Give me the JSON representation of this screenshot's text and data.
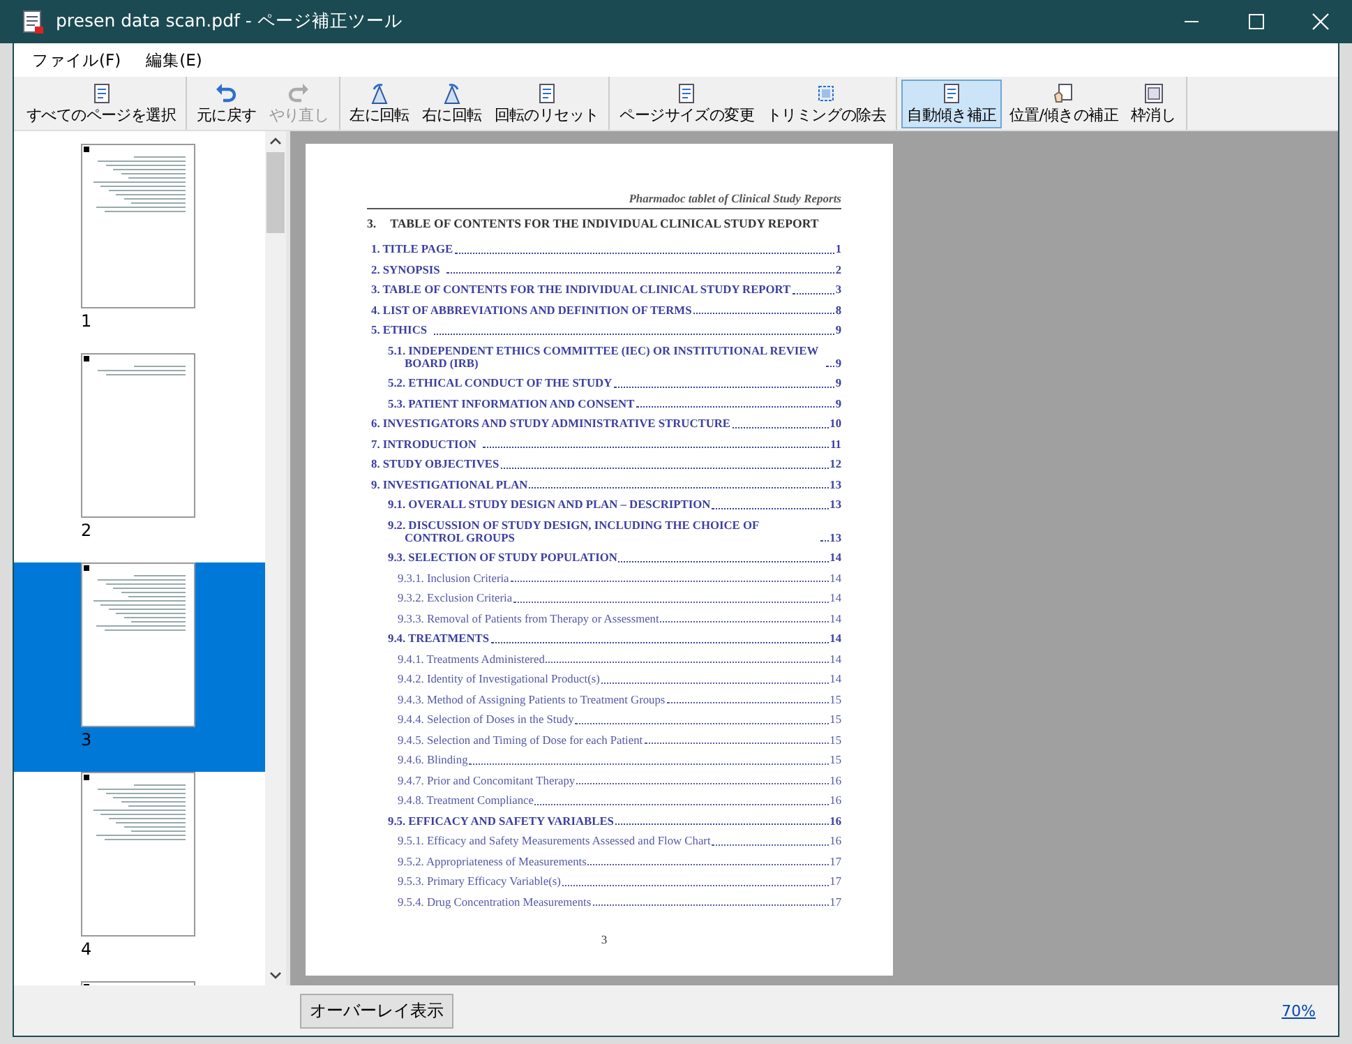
{
  "window": {
    "title": "presen data scan.pdf - ページ補正ツール"
  },
  "menu": [
    "ファイル(F)",
    "編集(E)"
  ],
  "toolbar": [
    [
      {
        "label": "すべてのページを選択",
        "kind": "pages",
        "disabled": false,
        "selected": false
      }
    ],
    [
      {
        "label": "元に戻す",
        "kind": "undo",
        "disabled": false,
        "selected": false
      },
      {
        "label": "やり直し",
        "kind": "redo",
        "disabled": true,
        "selected": false
      }
    ],
    [
      {
        "label": "左に回転",
        "kind": "rotate-left",
        "disabled": false,
        "selected": false
      },
      {
        "label": "右に回転",
        "kind": "rotate-right",
        "disabled": false,
        "selected": false
      },
      {
        "label": "回転のリセット",
        "kind": "reset",
        "disabled": false,
        "selected": false
      }
    ],
    [
      {
        "label": "ページサイズの変更",
        "kind": "page-size",
        "disabled": false,
        "selected": false
      },
      {
        "label": "トリミングの除去",
        "kind": "trim",
        "disabled": false,
        "selected": false
      }
    ],
    [
      {
        "label": "自動傾き補正",
        "kind": "deskew",
        "disabled": false,
        "selected": true
      },
      {
        "label": "位置/傾きの補正",
        "kind": "position",
        "disabled": false,
        "selected": false
      },
      {
        "label": "枠消し",
        "kind": "frame",
        "disabled": false,
        "selected": false
      }
    ]
  ],
  "thumbnails": [
    {
      "label": "1",
      "selected": false
    },
    {
      "label": "2",
      "selected": false
    },
    {
      "label": "3",
      "selected": true
    },
    {
      "label": "4",
      "selected": false
    },
    {
      "selected": false
    }
  ],
  "page": {
    "header": "Pharmadoc tablet of Clinical Study Reports",
    "heading_number": "3.",
    "heading": "TABLE OF CONTENTS FOR THE INDIVIDUAL CLINICAL STUDY REPORT",
    "page_number": "3",
    "toc": [
      {
        "text": "1. TITLE PAGE",
        "page": "1"
      },
      {
        "text": "2. SYNOPSIS",
        "page": "2"
      },
      {
        "text": "3. TABLE OF CONTENTS FOR THE INDIVIDUAL CLINICAL STUDY REPORT",
        "page": "3"
      },
      {
        "text": "4. LIST OF ABBREVIATIONS AND DEFINITION OF TERMS",
        "page": "8"
      },
      {
        "text": "5. ETHICS",
        "page": "9",
        "children": [
          {
            "text": "5.1. INDEPENDENT ETHICS COMMITTEE (IEC) OR INSTITUTIONAL REVIEW BOARD (IRB)",
            "page": "9"
          },
          {
            "text": "5.2. ETHICAL CONDUCT OF THE STUDY",
            "page": "9"
          },
          {
            "text": "5.3. PATIENT INFORMATION AND CONSENT",
            "page": "9"
          }
        ]
      },
      {
        "text": "6. INVESTIGATORS AND STUDY ADMINISTRATIVE STRUCTURE",
        "page": "10"
      },
      {
        "text": "7. INTRODUCTION",
        "page": "11"
      },
      {
        "text": "8. STUDY OBJECTIVES",
        "page": "12"
      },
      {
        "text": "9. INVESTIGATIONAL PLAN",
        "page": "13",
        "children": [
          {
            "text": "9.1. OVERALL STUDY DESIGN AND PLAN – DESCRIPTION",
            "page": "13"
          },
          {
            "text": "9.2. DISCUSSION OF STUDY DESIGN, INCLUDING THE CHOICE OF CONTROL GROUPS",
            "page": "13"
          },
          {
            "text": "9.3. SELECTION OF STUDY POPULATION",
            "page": "14",
            "children": [
              {
                "text": "9.3.1. Inclusion Criteria",
                "page": "14"
              },
              {
                "text": "9.3.2. Exclusion Criteria",
                "page": "14"
              },
              {
                "text": "9.3.3. Removal of Patients from Therapy or Assessment",
                "page": "14"
              }
            ]
          },
          {
            "text": "9.4. TREATMENTS",
            "page": "14",
            "children": [
              {
                "text": "9.4.1. Treatments Administered",
                "page": "14"
              },
              {
                "text": "9.4.2. Identity of Investigational Product(s)",
                "page": "14"
              },
              {
                "text": "9.4.3. Method of Assigning Patients to Treatment Groups",
                "page": "15"
              },
              {
                "text": "9.4.4. Selection of Doses in the Study",
                "page": "15"
              },
              {
                "text": "9.4.5. Selection and Timing of Dose for each Patient",
                "page": "15"
              },
              {
                "text": "9.4.6. Blinding",
                "page": "15"
              },
              {
                "text": "9.4.7. Prior and Concomitant Therapy",
                "page": "16"
              },
              {
                "text": "9.4.8. Treatment Compliance",
                "page": "16"
              }
            ]
          },
          {
            "text": "9.5. EFFICACY AND SAFETY VARIABLES",
            "page": "16",
            "children": [
              {
                "text": "9.5.1. Efficacy and Safety Measurements Assessed and Flow Chart",
                "page": "16"
              },
              {
                "text": "9.5.2. Appropriateness of Measurements",
                "page": "17"
              },
              {
                "text": "9.5.3. Primary Efficacy Variable(s)",
                "page": "17"
              },
              {
                "text": "9.5.4. Drug Concentration Measurements",
                "page": "17"
              }
            ]
          }
        ]
      }
    ]
  },
  "status_bar": {
    "overlay_button": "オーバーレイ表示",
    "zoom": "70%"
  }
}
